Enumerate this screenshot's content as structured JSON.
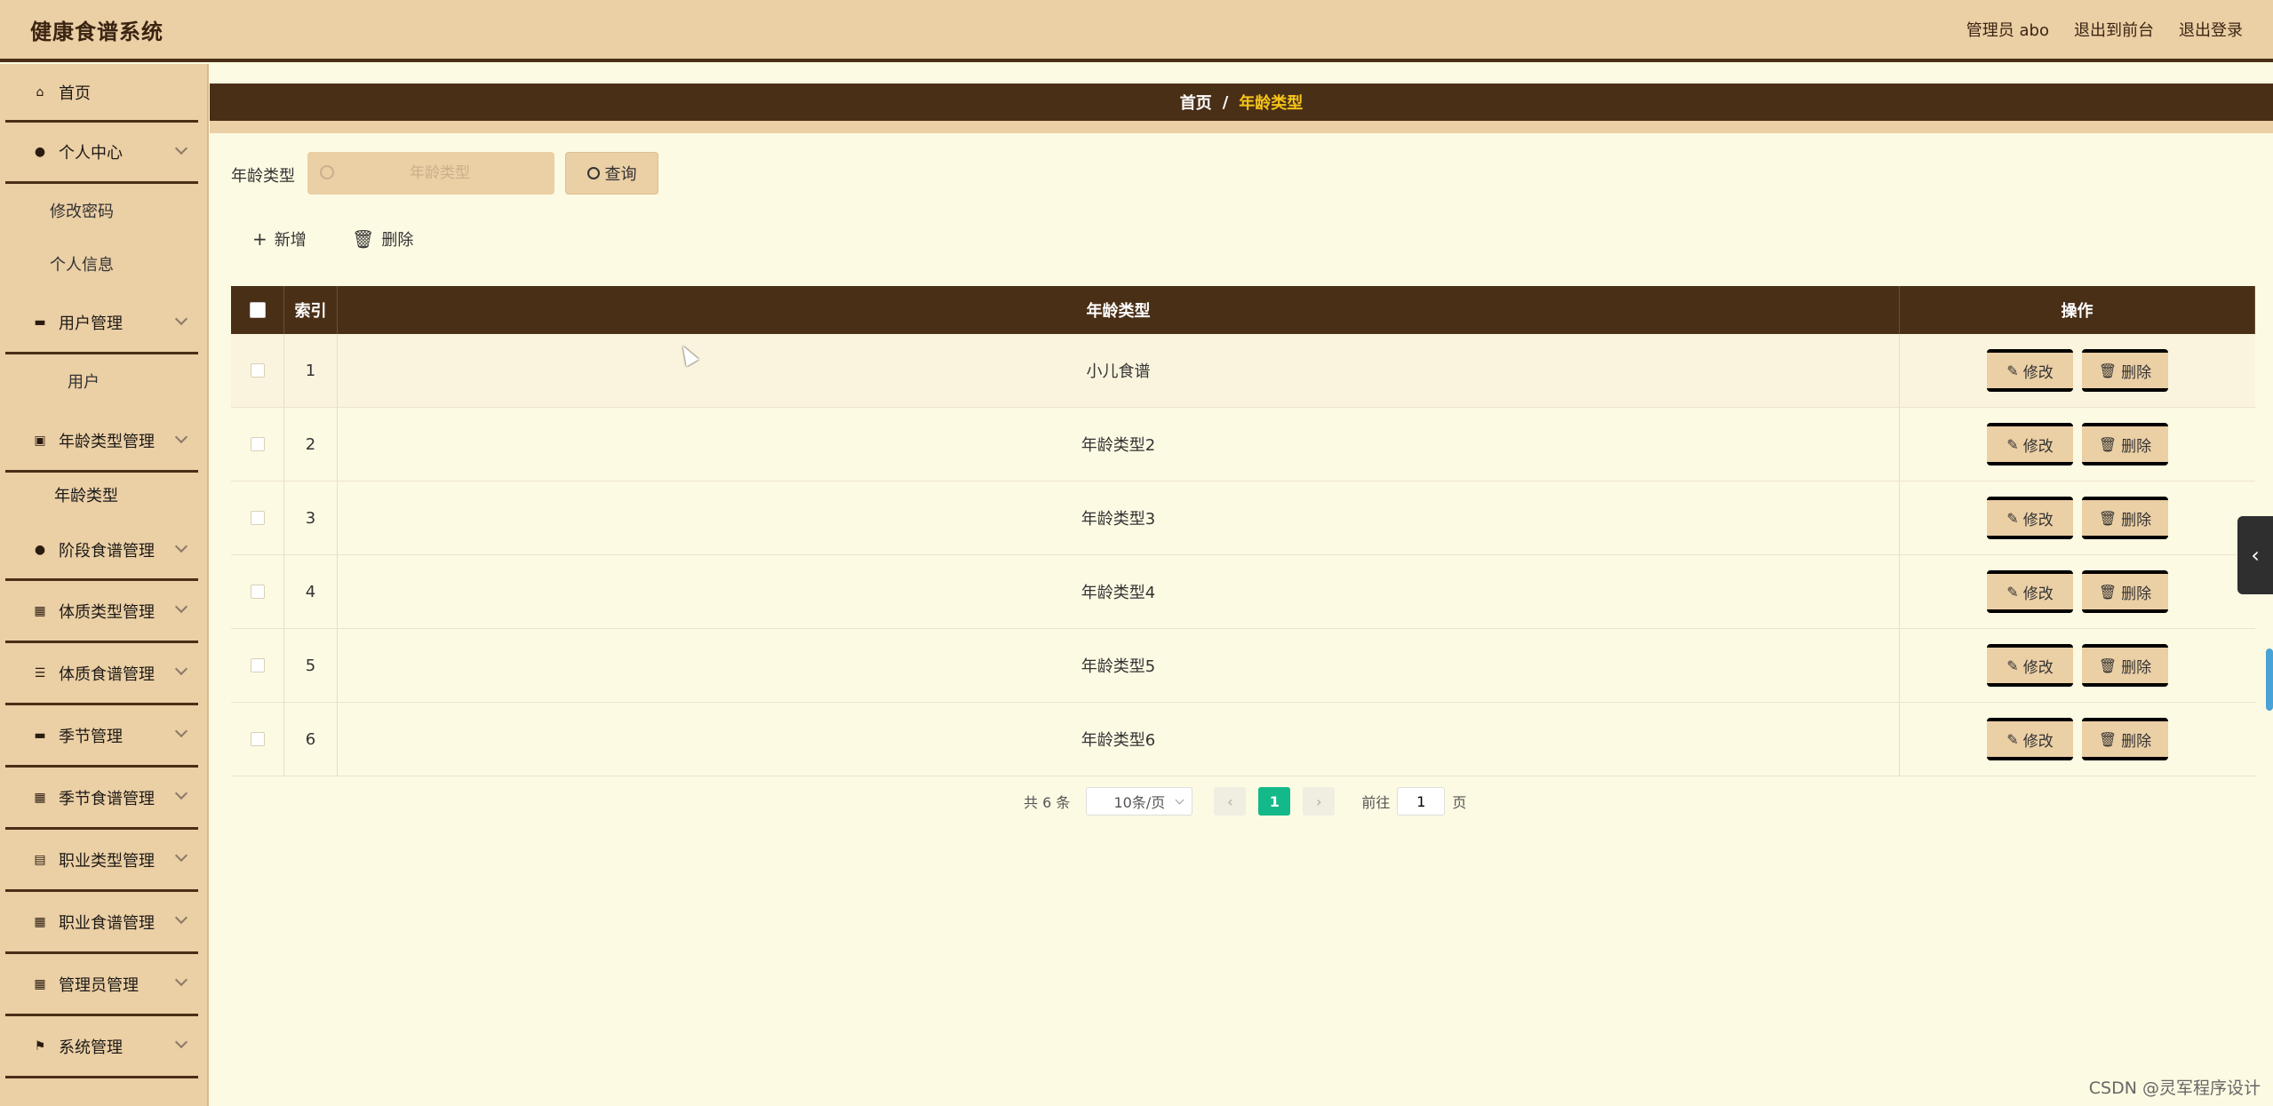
{
  "header": {
    "title": "健康食谱系统",
    "admin_label": "管理员 abo",
    "front_link": "退出到前台",
    "logout_link": "退出登录"
  },
  "sidebar": {
    "items": [
      {
        "label": "首页",
        "icon": "home-icon"
      },
      {
        "label": "个人中心",
        "icon": "user-icon"
      },
      {
        "label": "修改密码"
      },
      {
        "label": "个人信息"
      },
      {
        "label": "用户管理",
        "icon": "chat-icon"
      },
      {
        "label": "用户"
      },
      {
        "label": "年龄类型管理",
        "icon": "clipboard-icon"
      },
      {
        "label": "年龄类型"
      },
      {
        "label": "阶段食谱管理",
        "icon": "location-icon"
      },
      {
        "label": "体质类型管理",
        "icon": "grid-icon"
      },
      {
        "label": "体质食谱管理",
        "icon": "sliders-icon"
      },
      {
        "label": "季节管理",
        "icon": "monitor-icon"
      },
      {
        "label": "季节食谱管理",
        "icon": "grid-icon"
      },
      {
        "label": "职业类型管理",
        "icon": "doc-icon"
      },
      {
        "label": "职业食谱管理",
        "icon": "grid-icon"
      },
      {
        "label": "管理员管理",
        "icon": "grid-icon"
      },
      {
        "label": "系统管理",
        "icon": "flag-icon"
      }
    ]
  },
  "breadcrumb": {
    "home": "首页",
    "sep": "/",
    "current": "年龄类型"
  },
  "search": {
    "label": "年龄类型",
    "placeholder": "年龄类型",
    "value": "",
    "button": "查询"
  },
  "toolbar": {
    "add": "新增",
    "delete": "删除"
  },
  "table": {
    "headers": {
      "index": "索引",
      "type": "年龄类型",
      "actions": "操作"
    },
    "rows": [
      {
        "index": "1",
        "type": "小儿食谱"
      },
      {
        "index": "2",
        "type": "年龄类型2"
      },
      {
        "index": "3",
        "type": "年龄类型3"
      },
      {
        "index": "4",
        "type": "年龄类型4"
      },
      {
        "index": "5",
        "type": "年龄类型5"
      },
      {
        "index": "6",
        "type": "年龄类型6"
      }
    ],
    "edit_label": "修改",
    "delete_label": "删除"
  },
  "pagination": {
    "total": "共 6 条",
    "page_size": "10条/页",
    "current": "1",
    "goto_label": "前往",
    "goto_value": "1",
    "page_suffix": "页"
  },
  "watermark": "CSDN @灵军程序设计",
  "colors": {
    "header_bg": "#ebcfa5",
    "dark_brown": "#4a2f17",
    "content_bg": "#fdfae3",
    "page_active": "#14b98a",
    "crumb_current": "#f5c518"
  }
}
